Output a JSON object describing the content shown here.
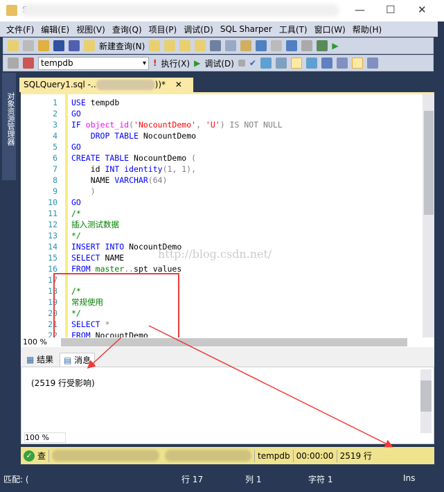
{
  "window": {
    "title_initial": "S",
    "minimize": "—",
    "maximize": "☐",
    "close": "✕"
  },
  "menu": [
    "文件(F)",
    "编辑(E)",
    "视图(V)",
    "查询(Q)",
    "项目(P)",
    "调试(D)",
    "SQL Sharper",
    "工具(T)",
    "窗口(W)",
    "帮助(H)"
  ],
  "toolbar": {
    "new_query": "新建查询(N)",
    "database": "tempdb",
    "execute": "执行(X)",
    "debug": "调试(D)"
  },
  "side_panel": "对象资源管理器",
  "doc_tab": {
    "title": "SQLQuery1.sql -..",
    "suffix": "))*",
    "close": "✕"
  },
  "editor": {
    "watermark": "http://blog.csdn.net/",
    "zoom": "100 %",
    "lines": [
      [
        [
          "kw",
          "USE"
        ],
        [
          "tx",
          " tempdb"
        ]
      ],
      [
        [
          "kw",
          "GO"
        ]
      ],
      [
        [
          "kw",
          "IF"
        ],
        [
          "tx",
          " "
        ],
        [
          "fn",
          "object_id"
        ],
        [
          "gr",
          "("
        ],
        [
          "str",
          "'NocountDemo'"
        ],
        [
          "gr",
          ", "
        ],
        [
          "str",
          "'U'"
        ],
        [
          "gr",
          ") IS NOT NULL"
        ]
      ],
      [
        [
          "tx",
          "    "
        ],
        [
          "kw",
          "DROP TABLE"
        ],
        [
          "tx",
          " NocountDemo"
        ]
      ],
      [
        [
          "kw",
          "GO"
        ]
      ],
      [
        [
          "kw",
          "CREATE TABLE"
        ],
        [
          "tx",
          " NocountDemo "
        ],
        [
          "gr",
          "("
        ]
      ],
      [
        [
          "tx",
          "    id "
        ],
        [
          "kw",
          "INT identity"
        ],
        [
          "gr",
          "(1, 1),"
        ]
      ],
      [
        [
          "tx",
          "    NAME "
        ],
        [
          "kw",
          "VARCHAR"
        ],
        [
          "gr",
          "(64)"
        ]
      ],
      [
        [
          "gr",
          "    )"
        ]
      ],
      [
        [
          "kw",
          "GO"
        ]
      ],
      [
        [
          "cm",
          "/*"
        ]
      ],
      [
        [
          "cm",
          "插入测试数据"
        ]
      ],
      [
        [
          "cm",
          "*/"
        ]
      ],
      [
        [
          "kw",
          "INSERT INTO"
        ],
        [
          "tx",
          " NocountDemo"
        ]
      ],
      [
        [
          "kw",
          "SELECT"
        ],
        [
          "tx",
          " NAME"
        ]
      ],
      [
        [
          "kw",
          "FROM"
        ],
        [
          "tx",
          " "
        ],
        [
          "cm",
          "master"
        ],
        [
          "gr",
          ".."
        ],
        [
          "tx",
          "spt_values"
        ]
      ],
      [],
      [
        [
          "cm",
          "/*"
        ]
      ],
      [
        [
          "cm",
          "常规使用"
        ]
      ],
      [
        [
          "cm",
          "*/"
        ]
      ],
      [
        [
          "kw",
          "SELECT"
        ],
        [
          "gr",
          " *"
        ]
      ],
      [
        [
          "kw",
          "FROM"
        ],
        [
          "tx",
          " NocountDemo"
        ]
      ]
    ]
  },
  "results": {
    "tabs": [
      "结果",
      "消息"
    ],
    "message": "(2519 行受影响)",
    "zoom": "100 %"
  },
  "status": {
    "icon": "success-check",
    "state": "查",
    "database": "tempdb",
    "elapsed": "00:00:00",
    "rows": "2519 行"
  },
  "bottom_status": {
    "match": "匹配: (",
    "line": "行 17",
    "col": "列 1",
    "char": "字符 1",
    "mode": "Ins"
  },
  "colors": {
    "frame": "#293955",
    "status": "#efe38e",
    "annotation": "#f03a3a"
  }
}
